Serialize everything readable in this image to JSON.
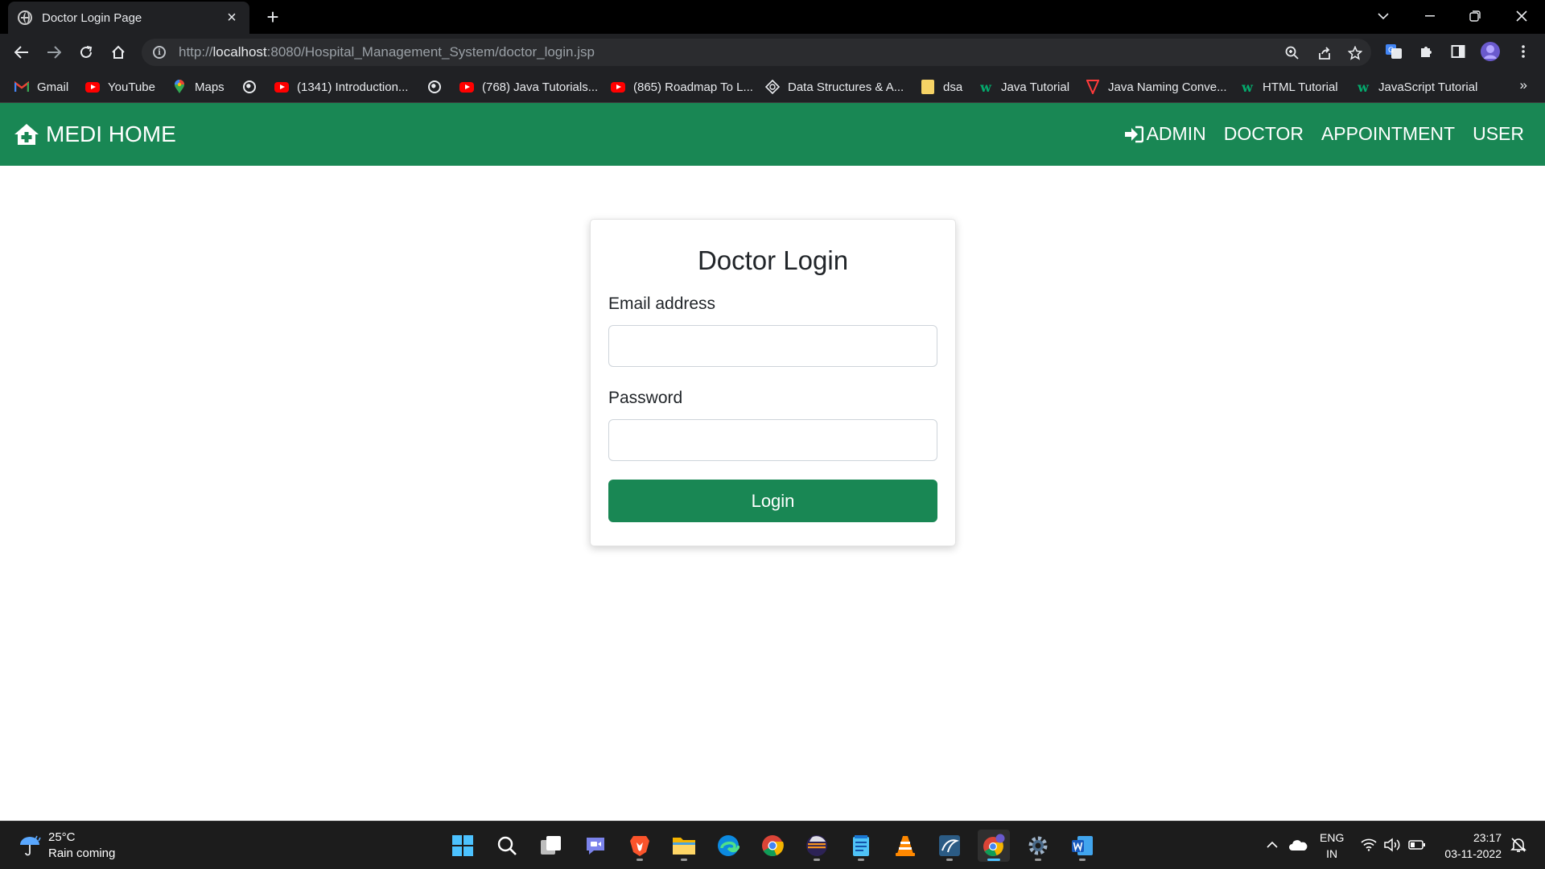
{
  "browser": {
    "tab_title": "Doctor Login Page",
    "new_tab_glyph": "+",
    "url_scheme": "http://",
    "url_host": "localhost",
    "url_path": ":8080/Hospital_Management_System/doctor_login.jsp",
    "bookmarks": [
      {
        "label": "Gmail",
        "icon": "gmail-icon"
      },
      {
        "label": "YouTube",
        "icon": "youtube-icon"
      },
      {
        "label": "Maps",
        "icon": "maps-icon"
      },
      {
        "label": "",
        "icon": "globe-icon"
      },
      {
        "label": "(1341) Introduction...",
        "icon": "youtube-icon"
      },
      {
        "label": "",
        "icon": "globe-icon"
      },
      {
        "label": "(768) Java Tutorials...",
        "icon": "youtube-icon"
      },
      {
        "label": "(865) Roadmap To L...",
        "icon": "youtube-icon"
      },
      {
        "label": "Data Structures & A...",
        "icon": "site-icon"
      },
      {
        "label": "dsa",
        "icon": "folder-icon"
      },
      {
        "label": "Java Tutorial",
        "icon": "w3schools-icon"
      },
      {
        "label": "Java Naming Conve...",
        "icon": "site-icon"
      },
      {
        "label": "HTML Tutorial",
        "icon": "w3schools-icon"
      },
      {
        "label": "JavaScript Tutorial",
        "icon": "w3schools-icon"
      }
    ],
    "bookmarks_more": "»"
  },
  "navbar": {
    "brand": "MEDI HOME",
    "links": [
      "ADMIN",
      "DOCTOR",
      "APPOINTMENT",
      "USER"
    ]
  },
  "login": {
    "title": "Doctor Login",
    "email_label": "Email address",
    "email_value": "",
    "password_label": "Password",
    "password_value": "",
    "submit_label": "Login"
  },
  "taskbar": {
    "weather_temp": "25°C",
    "weather_desc": "Rain coming",
    "lang_line1": "ENG",
    "lang_line2": "IN",
    "time": "23:17",
    "date": "03-11-2022"
  },
  "colors": {
    "brand_green": "#198754",
    "browser_dark": "#202124"
  }
}
